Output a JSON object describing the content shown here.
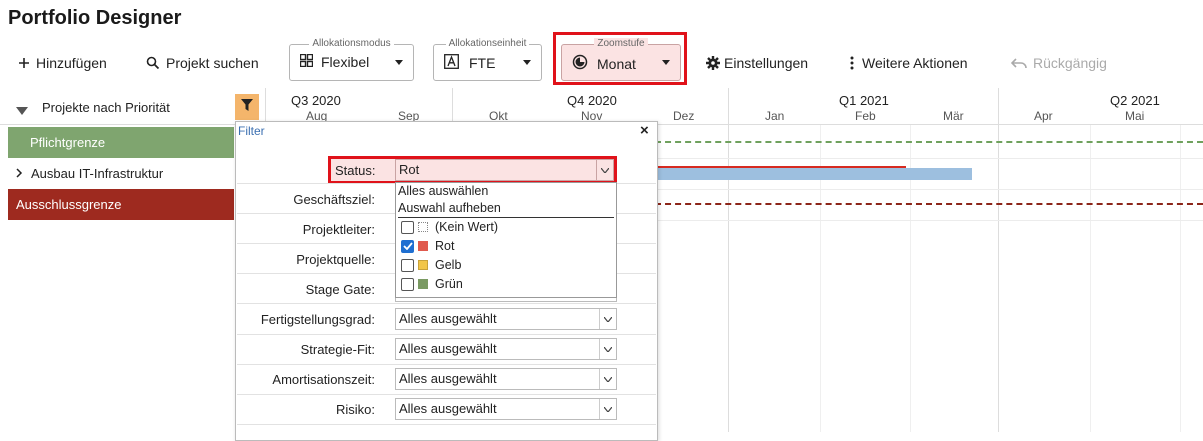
{
  "app": {
    "title": "Portfolio Designer"
  },
  "toolbar": {
    "add": "Hinzufügen",
    "search": "Projekt suchen",
    "allocation_mode": {
      "legend": "Allokationsmodus",
      "value": "Flexibel"
    },
    "allocation_unit": {
      "legend": "Allokationseinheit",
      "value": "FTE"
    },
    "zoom": {
      "legend": "Zoomstufe",
      "value": "Monat"
    },
    "settings": "Einstellungen",
    "more": "Weitere Aktionen",
    "undo": "Rückgängig"
  },
  "left_panel": {
    "header": "Projekte nach Priorität",
    "rows": [
      "Pflichtgrenze",
      "Ausbau IT-Infrastruktur",
      "Ausschlussgrenze"
    ]
  },
  "timeline": {
    "quarters": [
      "Q3 2020",
      "Q4 2020",
      "Q1 2021",
      "Q2 2021"
    ],
    "months": [
      "Aug",
      "Sep",
      "Okt",
      "Nov",
      "Dez",
      "Jan",
      "Feb",
      "Mär",
      "Apr",
      "Mai"
    ]
  },
  "filter": {
    "title": "Filter",
    "close": "×",
    "status": {
      "label": "Status:",
      "value": "Rot"
    },
    "fields": [
      {
        "label": "Geschäftsziel:"
      },
      {
        "label": "Projektleiter:"
      },
      {
        "label": "Projektquelle:"
      },
      {
        "label": "Stage Gate:"
      },
      {
        "label": "Fertigstellungsgrad:",
        "value": "Alles ausgewählt"
      },
      {
        "label": "Strategie-Fit:",
        "value": "Alles ausgewählt"
      },
      {
        "label": "Amortisationszeit:",
        "value": "Alles ausgewählt"
      },
      {
        "label": "Risiko:",
        "value": "Alles ausgewählt"
      }
    ],
    "dropdown": {
      "select_all": "Alles auswählen",
      "deselect_all": "Auswahl aufheben",
      "options": [
        {
          "label": "(Kein Wert)",
          "checked": false,
          "color": "#ffffff"
        },
        {
          "label": "Rot",
          "checked": true,
          "color": "#e05a4e"
        },
        {
          "label": "Gelb",
          "checked": false,
          "color": "#f2c649"
        },
        {
          "label": "Grün",
          "checked": false,
          "color": "#7a9a62"
        }
      ]
    }
  },
  "colors": {
    "pflicht": "#7fa56f",
    "ausschluss": "#9e2a1f",
    "filter_active": "#f4b56b",
    "highlight": "#e0121a",
    "bar": "#9dbfdf"
  }
}
